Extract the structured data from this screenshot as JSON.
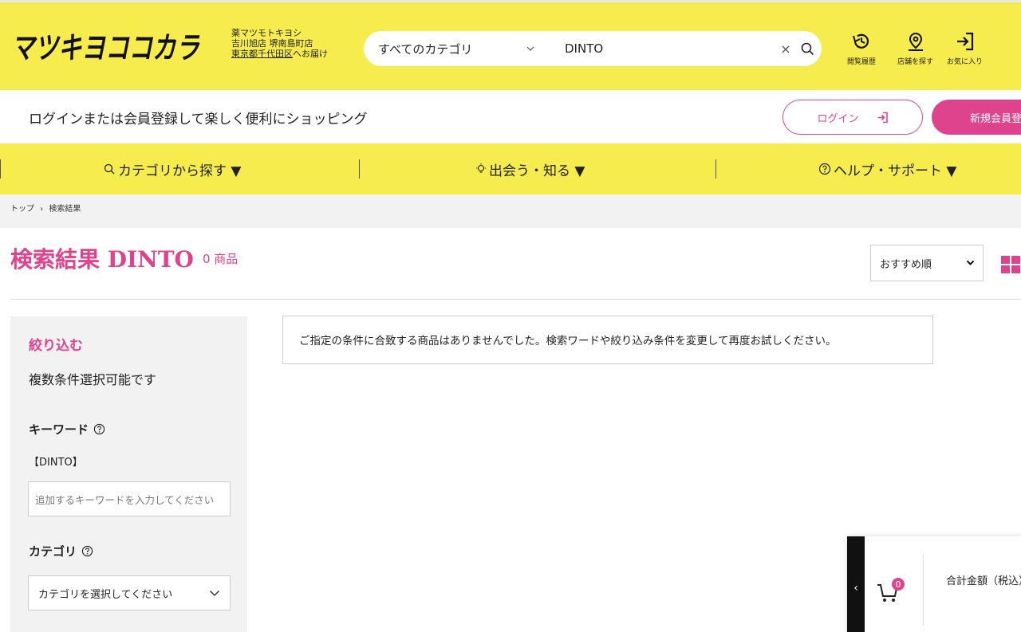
{
  "header": {
    "logo_text": "マツキヨココカラ",
    "store_line1": "薬マツモトキヨシ",
    "store_line2": "吉川旭店 堺南島町店",
    "store_link": "東京都千代田区",
    "store_suffix": "へお届け",
    "search_category": "すべてのカテゴリ",
    "search_keyword": "DINTO",
    "clear_symbol": "×",
    "icons": [
      {
        "label": "閲覧履歴",
        "icon": "history-icon"
      },
      {
        "label": "店舗を探す",
        "icon": "location-pin-icon"
      },
      {
        "label": "お気に入り",
        "icon": "login-arrow-icon"
      }
    ],
    "accent": "#e0438e",
    "bg": "#f6ec4e"
  },
  "loginbar": {
    "message": "ログインまたは会員登録して楽しく便利にショッピング",
    "login_label": "ログイン",
    "register_label": "新規会員登録"
  },
  "nav": {
    "items": [
      "カテゴリから探す ▼",
      "出会う・知る ▼",
      "ヘルプ・サポート ▼"
    ]
  },
  "breadcrumb": {
    "home": "トップ",
    "sep": "›",
    "current": "検索結果"
  },
  "results": {
    "title": "検索結果 DINTO",
    "count": "0 商品",
    "sort_label": "おすすめ順",
    "message": "ご指定の条件に合致する商品はありませんでした。検索ワードや絞り込み条件を変更して再度お試しください。"
  },
  "sidebar": {
    "title": "絞り込む",
    "subtitle": "複数条件選択可能です",
    "keyword_heading": "キーワード",
    "keyword_value": "【DINTO】",
    "keyword_placeholder": "追加するキーワードを入力してください",
    "category_heading": "カテゴリ",
    "category_select": "カテゴリを選択してください"
  },
  "cart": {
    "count": "0",
    "total_label": "合計金額（税込）",
    "tab_symbol": "‹"
  }
}
